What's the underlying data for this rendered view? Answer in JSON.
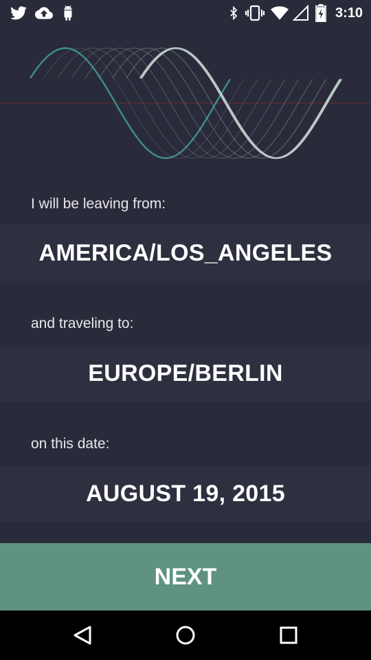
{
  "status_bar": {
    "time": "3:10",
    "left_icons": [
      "twitter-icon",
      "cloud-upload-icon",
      "android-icon"
    ],
    "right_icons": [
      "bluetooth-icon",
      "vibrate-icon",
      "wifi-icon",
      "signal-icon",
      "battery-charging-icon"
    ]
  },
  "origin": {
    "prompt": "I will be leaving from:",
    "value": "AMERICA/LOS_ANGELES"
  },
  "destination": {
    "prompt": "and traveling to:",
    "value": "EUROPE/BERLIN"
  },
  "travel_date": {
    "prompt": "on this date:",
    "value": "AUGUST 19, 2015"
  },
  "next_button": {
    "label": "NEXT"
  },
  "nav_bar": {
    "buttons": [
      "back-icon",
      "home-icon",
      "recents-icon"
    ]
  },
  "colors": {
    "background": "#2a2b3a",
    "value_band": "#2e2f3f",
    "accent": "#5f9282",
    "wave_teal": "#3e8e90",
    "wave_light": "#b8c8c4",
    "divider": "#4a2a38"
  }
}
